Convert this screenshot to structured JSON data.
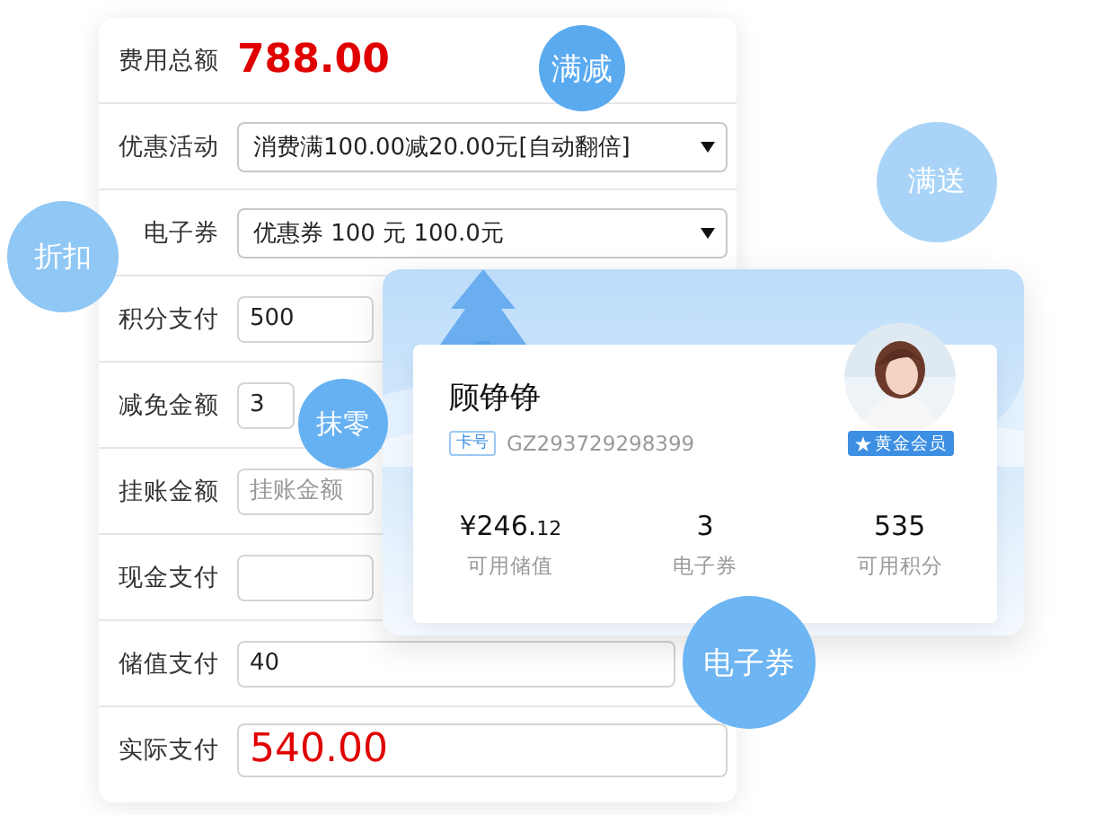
{
  "form": {
    "rows": [
      {
        "label": "费用总额",
        "kind": "amount",
        "value": "788.00"
      },
      {
        "label": "优惠活动",
        "kind": "select",
        "value": "消费满100.00减20.00元[自动翻倍]"
      },
      {
        "label": "电子券",
        "kind": "select",
        "value": "优惠券 100 元 100.0元"
      },
      {
        "label": "积分支付",
        "kind": "input",
        "value": "500"
      },
      {
        "label": "减免金额",
        "kind": "input",
        "value": "3"
      },
      {
        "label": "挂账金额",
        "kind": "input",
        "placeholder": "挂账金额"
      },
      {
        "label": "现金支付",
        "kind": "input"
      },
      {
        "label": "储值支付",
        "kind": "input",
        "value": "40"
      },
      {
        "label": "实际支付",
        "kind": "total",
        "value": "540.00"
      }
    ]
  },
  "member_card": {
    "name": "顾铮铮",
    "card_label": "卡号",
    "card_number": "GZ293729298399",
    "badge": "黄金会员",
    "stats": [
      {
        "value": "¥246.",
        "fraction": "12",
        "label": "可用储值"
      },
      {
        "value": "3",
        "label": "电子券"
      },
      {
        "value": "535",
        "label": "可用积分"
      }
    ]
  },
  "bubbles": [
    {
      "label": "满减",
      "color": "#5aaaf0"
    },
    {
      "label": "满送",
      "color": "#a9d4f7"
    },
    {
      "label": "折扣",
      "color": "#8fc7f5"
    },
    {
      "label": "抹零",
      "color": "#66b1f2"
    },
    {
      "label": "电子券",
      "color": "#6db5f3"
    }
  ]
}
